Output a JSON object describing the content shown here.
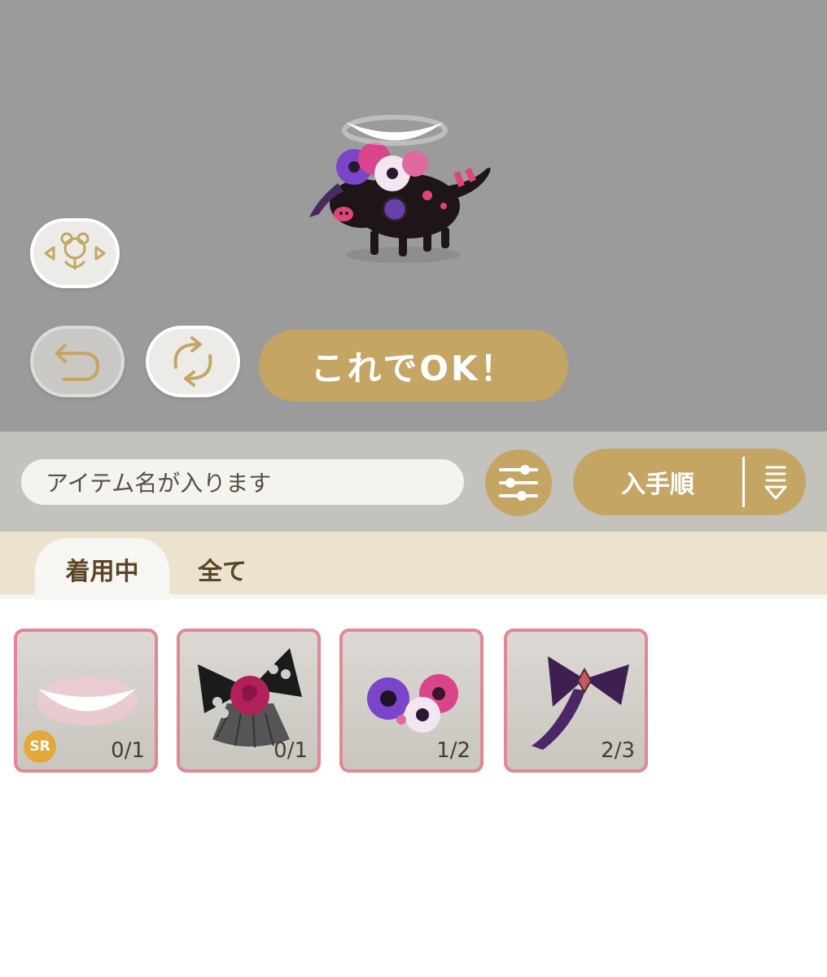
{
  "preview": {
    "confirm_label": "これでOK！"
  },
  "search": {
    "placeholder": "アイテム名が入ります"
  },
  "sort": {
    "label": "入手順"
  },
  "tabs": [
    {
      "label": "着用中",
      "active": true
    },
    {
      "label": "全て",
      "active": false
    }
  ],
  "items": [
    {
      "name": "halo",
      "rarity": "SR",
      "count": "0/1"
    },
    {
      "name": "rose-lace-bow",
      "count": "0/1"
    },
    {
      "name": "anemone-flowers",
      "count": "1/2"
    },
    {
      "name": "purple-ribbon",
      "count": "2/3"
    }
  ],
  "icons": {
    "pose": "pose-icon",
    "undo": "undo-icon",
    "reset": "reset-icon",
    "filter": "filter-sliders-icon",
    "sort_order": "sort-order-icon"
  },
  "colors": {
    "accent_gold": "#c5a564",
    "card_border": "#e28795",
    "preview_bg": "#9b9b9b",
    "tab_bg": "#ece3cf"
  }
}
